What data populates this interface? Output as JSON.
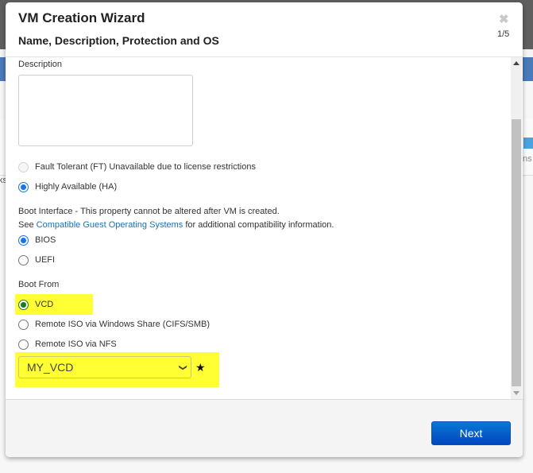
{
  "background": {
    "left_fragment_text": "ks",
    "right_fragment_text": "ns"
  },
  "modal": {
    "title": "VM Creation Wizard",
    "subtitle": "Name, Description, Protection and OS",
    "close_icon": "close-x-icon",
    "step_indicator": "1/5"
  },
  "form": {
    "description": {
      "label": "Description",
      "value": ""
    },
    "protection": {
      "options": [
        {
          "label": "Fault Tolerant (FT) Unavailable due to license restrictions",
          "checked": false,
          "disabled": true
        },
        {
          "label": "Highly Available (HA)",
          "checked": true,
          "disabled": false
        }
      ]
    },
    "boot_interface": {
      "heading": "Boot Interface",
      "note": " - This property cannot be altered after VM is created.",
      "see_prefix": "See ",
      "link_text": "Compatible Guest Operating Systems",
      "see_suffix": " for additional compatibility information.",
      "options": [
        {
          "label": "BIOS",
          "checked": true
        },
        {
          "label": "UEFI",
          "checked": false
        }
      ]
    },
    "boot_from": {
      "heading": "Boot From",
      "options": [
        {
          "label": "VCD",
          "checked": true
        },
        {
          "label": "Remote ISO via Windows Share (CIFS/SMB)",
          "checked": false
        },
        {
          "label": "Remote ISO via NFS",
          "checked": false
        }
      ],
      "select_value": "MY_VCD",
      "required_marker": "★"
    }
  },
  "footer": {
    "next_label": "Next"
  },
  "colors": {
    "accent_blue": "#1a73e8",
    "link": "#1a6fb5",
    "highlight": "#ffff33",
    "button": "#0a66cc"
  }
}
